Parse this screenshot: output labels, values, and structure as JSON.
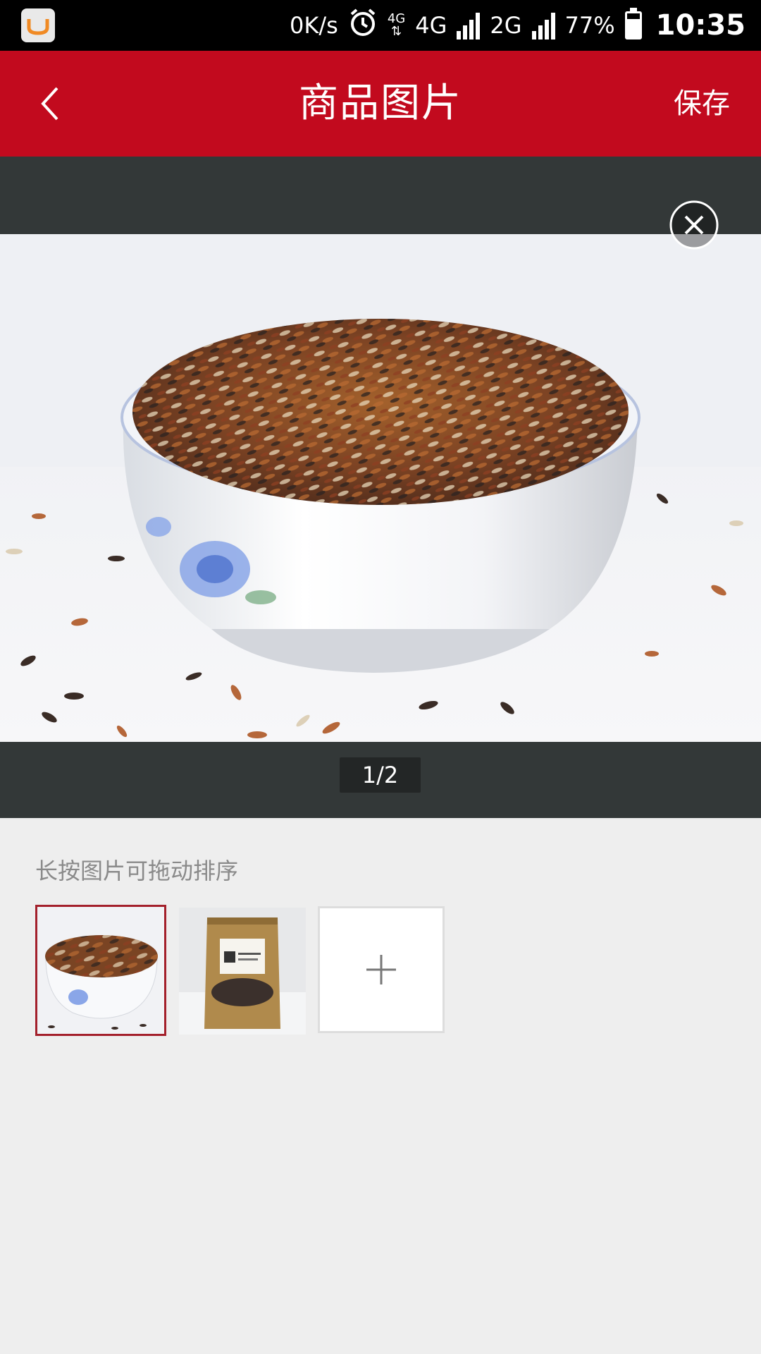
{
  "status_bar": {
    "speed": "0K/s",
    "network_1_small": "4G",
    "network_1": "4G",
    "network_2": "2G",
    "battery_percent": "77%",
    "battery_level": 0.77,
    "time": "10:35"
  },
  "app_bar": {
    "title": "商品图片",
    "save_label": "保存"
  },
  "preview": {
    "page_indicator": "1/2"
  },
  "sort": {
    "hint": "长按图片可拖动排序"
  },
  "colors": {
    "brand_red": "#c20a1e",
    "preview_bg": "#333838",
    "selected_border": "#a3202b",
    "page_bg": "#eeeeee"
  },
  "icons": {
    "back": "chevron-left-icon",
    "close": "close-circle-icon",
    "add": "plus-icon",
    "alarm": "alarm-icon"
  }
}
